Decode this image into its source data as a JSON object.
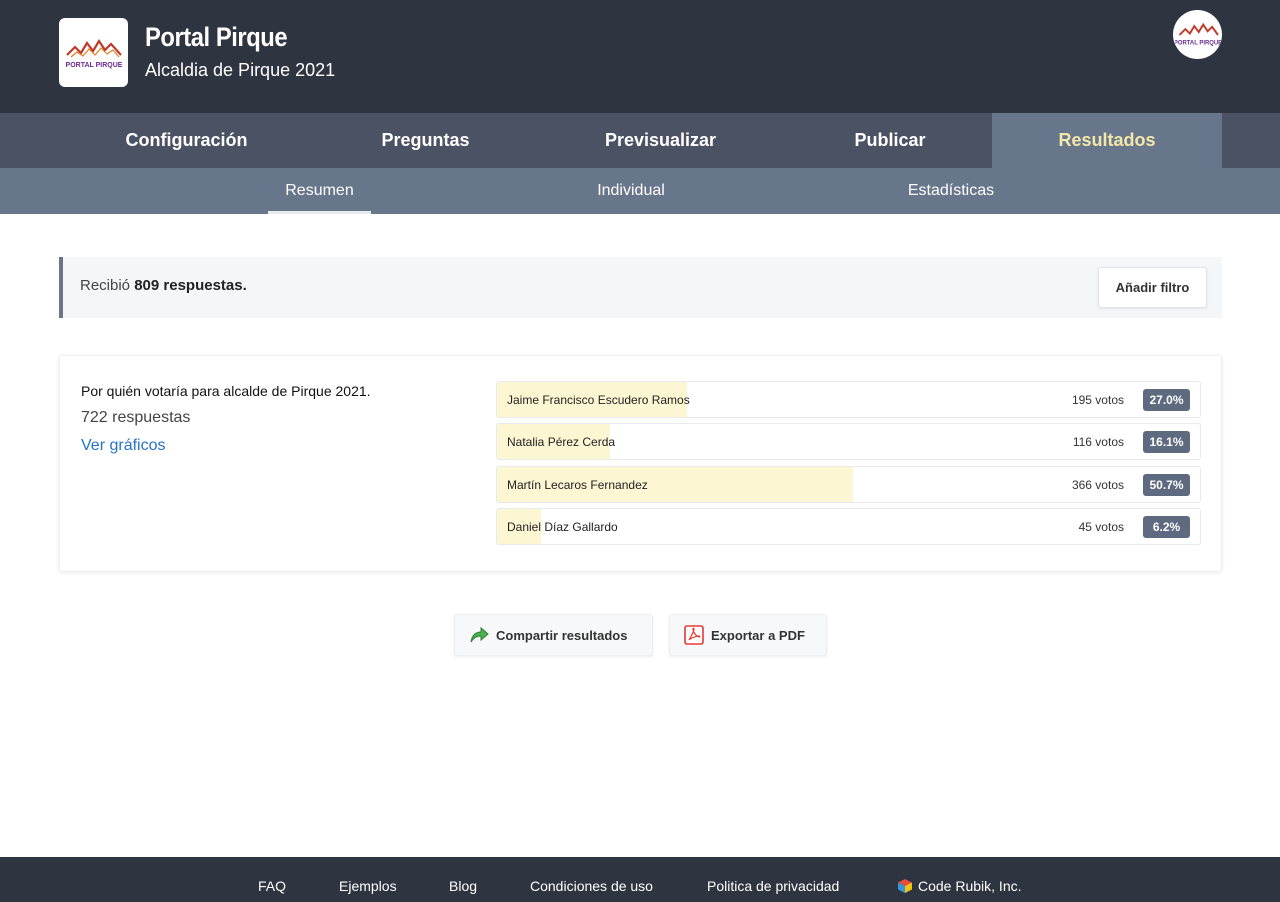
{
  "header": {
    "brand_title": "Portal Pirque",
    "brand_subtitle": "Alcaldia de Pirque 2021",
    "logo_text": "PORTAL PIRQUE"
  },
  "tabs": [
    {
      "label": "Configuración",
      "active": false
    },
    {
      "label": "Preguntas",
      "active": false
    },
    {
      "label": "Previsualizar",
      "active": false
    },
    {
      "label": "Publicar",
      "active": false
    },
    {
      "label": "Resultados",
      "active": true
    }
  ],
  "subtabs": [
    {
      "label": "Resumen",
      "active": true
    },
    {
      "label": "Individual",
      "active": false
    },
    {
      "label": "Estadísticas",
      "active": false
    }
  ],
  "summary": {
    "prefix": "Recibió",
    "count_text": "809 respuestas.",
    "filter_button": "Añadir filtro"
  },
  "question": {
    "title": "Por quién votaría para alcalde de Pirque 2021.",
    "responses": "722 respuestas",
    "link": "Ver gráficos",
    "options": [
      {
        "label": "Jaime Francisco Escudero Ramos",
        "votes": "195 votos",
        "percent_text": "27.0%",
        "percent": 27.0
      },
      {
        "label": "Natalia Pérez Cerda",
        "votes": "116 votos",
        "percent_text": "16.1%",
        "percent": 16.1
      },
      {
        "label": "Martín Lecaros Fernandez",
        "votes": "366 votos",
        "percent_text": "50.7%",
        "percent": 50.7
      },
      {
        "label": "Daniel Díaz Gallardo",
        "votes": "45 votos",
        "percent_text": "6.2%",
        "percent": 6.2
      }
    ]
  },
  "actions": {
    "share": "Compartir resultados",
    "pdf": "Exportar a PDF"
  },
  "footer": {
    "links": [
      "FAQ",
      "Ejemplos",
      "Blog",
      "Condiciones de uso",
      "Politica de privacidad"
    ],
    "company": "Code Rubik, Inc."
  },
  "colors": {
    "header_bg": "#2f3441",
    "tab_bg": "#4a5263",
    "tab_active_bg": "#68768c",
    "tab_active_text": "#f3e7a7",
    "bar_fill": "#fdf6d3",
    "badge_bg": "#5e6a80",
    "link": "#2474c9"
  },
  "icons": {
    "share": "share-arrow-icon",
    "pdf": "pdf-icon",
    "company": "cube-icon"
  }
}
